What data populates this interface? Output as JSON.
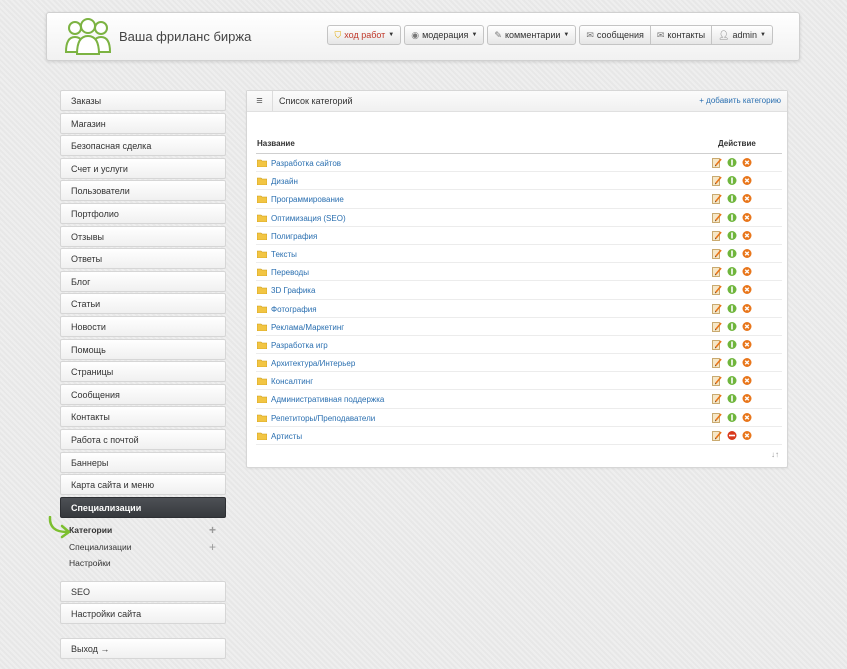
{
  "header": {
    "site_title": "Ваша фриланс биржа",
    "menu": [
      {
        "label": "ход работ",
        "icon": "shield-icon",
        "active": true
      },
      {
        "label": "модерация",
        "icon": "eye-icon"
      },
      {
        "label": "комментарии",
        "icon": "pencil-icon"
      }
    ],
    "group": [
      {
        "label": "сообщения",
        "icon": "envelope-icon"
      },
      {
        "label": "контакты",
        "icon": "contacts-icon"
      },
      {
        "label": "admin",
        "icon": "user-icon"
      }
    ]
  },
  "sidebar": {
    "items": [
      "Заказы",
      "Магазин",
      "Безопасная сделка",
      "Счет и услуги",
      "Пользователи",
      "Портфолио",
      "Отзывы",
      "Ответы",
      "Блог",
      "Статьи",
      "Новости",
      "Помощь",
      "Страницы",
      "Сообщения",
      "Контакты",
      "Работа с почтой",
      "Баннеры",
      "Карта сайта и меню"
    ],
    "active_item": "Специализации",
    "subitems": [
      "Категории",
      "Специализации",
      "Настройки"
    ],
    "after_items": [
      "SEO",
      "Настройки сайта"
    ],
    "logout": "Выход →"
  },
  "panel": {
    "title": "Список категорий",
    "add_link": "+ добавить категорию",
    "col_name": "Название",
    "col_action": "Действие",
    "rows": [
      {
        "name": "Разработка сайтов",
        "enabled": true
      },
      {
        "name": "Дизайн",
        "enabled": true
      },
      {
        "name": "Программирование",
        "enabled": true
      },
      {
        "name": "Оптимизация (SEO)",
        "enabled": true
      },
      {
        "name": "Полиграфия",
        "enabled": true
      },
      {
        "name": "Тексты",
        "enabled": true
      },
      {
        "name": "Переводы",
        "enabled": true
      },
      {
        "name": "3D Графика",
        "enabled": true
      },
      {
        "name": "Фотография",
        "enabled": true
      },
      {
        "name": "Реклама/Маркетинг",
        "enabled": true
      },
      {
        "name": "Разработка игр",
        "enabled": true
      },
      {
        "name": "Архитектура/Интерьер",
        "enabled": true
      },
      {
        "name": "Консалтинг",
        "enabled": true
      },
      {
        "name": "Административная поддержка",
        "enabled": true
      },
      {
        "name": "Репетиторы/Преподаватели",
        "enabled": true
      },
      {
        "name": "Артисты",
        "enabled": false
      }
    ],
    "sort_icon": "↓↑"
  },
  "colors": {
    "link": "#2a6fb0",
    "active_nav": "#3d4044",
    "enable_green": "#6fb53c",
    "disable_red": "#d9391c",
    "delete_orange": "#e8761b",
    "folder_yellow": "#f2c543",
    "arrow_green": "#7cbf2f"
  }
}
